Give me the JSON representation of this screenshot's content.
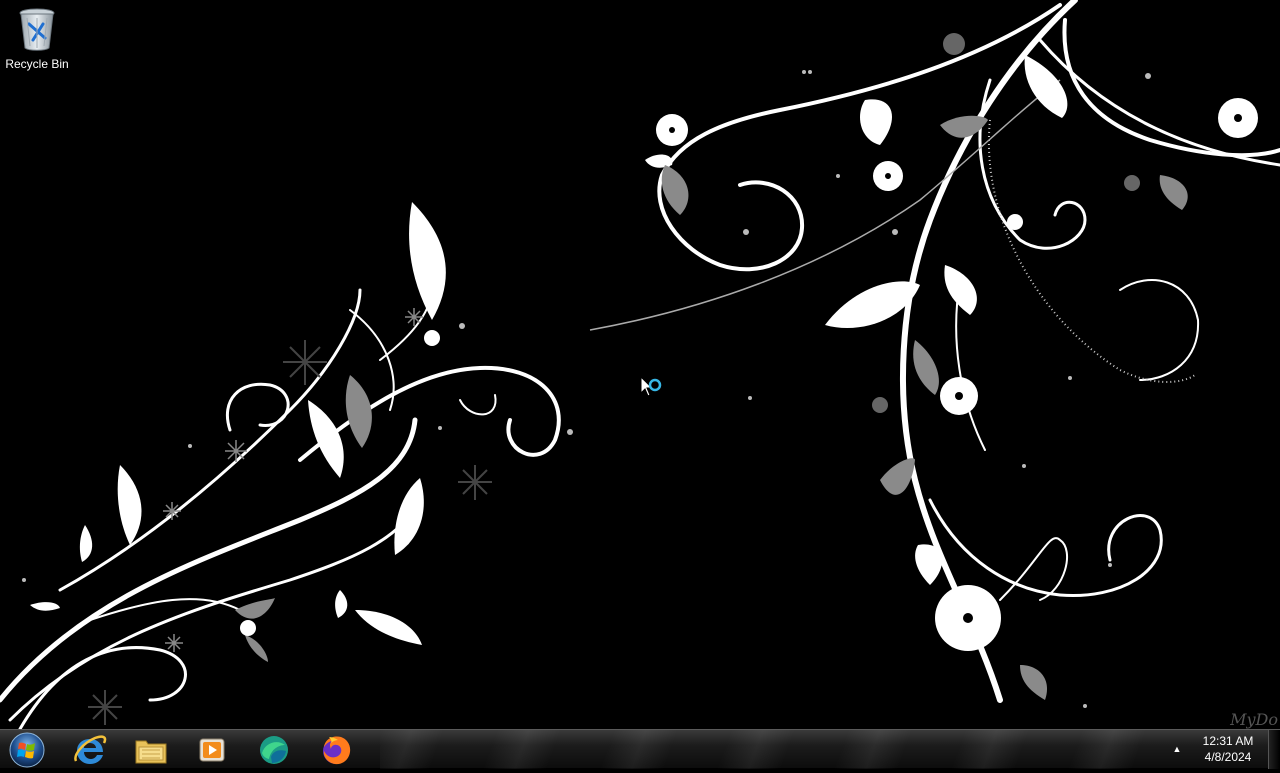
{
  "desktop": {
    "icons": [
      {
        "label": "Recycle Bin",
        "icon": "recycle-bin-icon"
      }
    ],
    "watermark": "MyDo"
  },
  "taskbar": {
    "start_icon": "windows-start-icon",
    "pinned": [
      {
        "name": "Internet Explorer",
        "icon": "internet-explorer-icon"
      },
      {
        "name": "Windows Explorer",
        "icon": "file-explorer-icon"
      },
      {
        "name": "Windows Media Player",
        "icon": "media-player-icon"
      },
      {
        "name": "Browser",
        "icon": "browser-icon"
      },
      {
        "name": "Firefox",
        "icon": "firefox-icon"
      }
    ],
    "tray": {
      "time": "12:31 AM",
      "date": "4/8/2024"
    }
  },
  "colors": {
    "wallpaper_bg": "#000000",
    "swirl": "#ffffff",
    "leaf_gray": "#8a8a8a",
    "busy_ring": "#37b7e6"
  }
}
